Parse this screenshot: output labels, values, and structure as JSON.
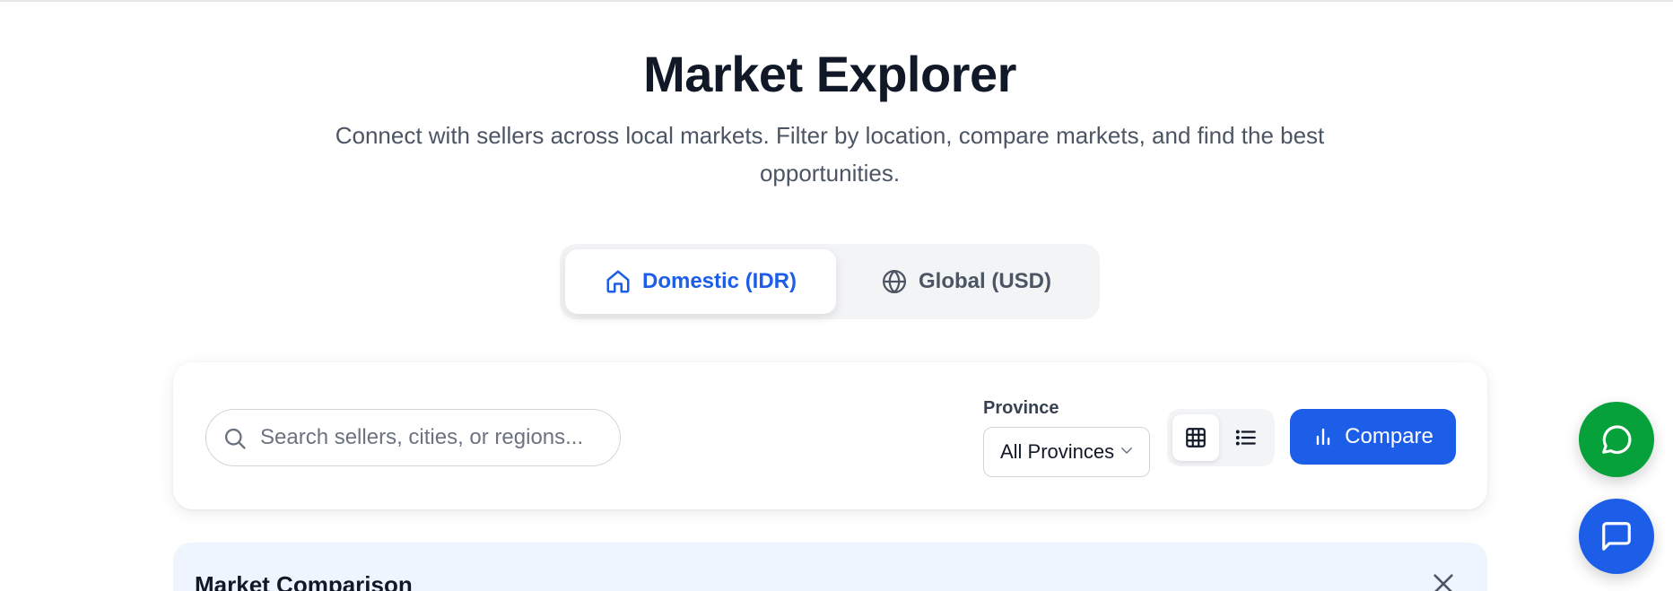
{
  "header": {
    "title": "Market Explorer",
    "subtitle": "Connect with sellers across local markets. Filter by location, compare markets, and find the best opportunities."
  },
  "market_toggle": {
    "domestic_label": "Domestic (IDR)",
    "global_label": "Global (USD)",
    "selected": "domestic"
  },
  "filters": {
    "search_placeholder": "Search sellers, cities, or regions...",
    "search_value": "",
    "province_label": "Province",
    "province_selected": "All Provinces",
    "view_mode": "grid",
    "compare_label": "Compare"
  },
  "comparison": {
    "title": "Market Comparison"
  },
  "colors": {
    "accent": "#1d5ee8",
    "whatsapp": "#06a13a",
    "comparison_bg": "#eff5ff"
  }
}
